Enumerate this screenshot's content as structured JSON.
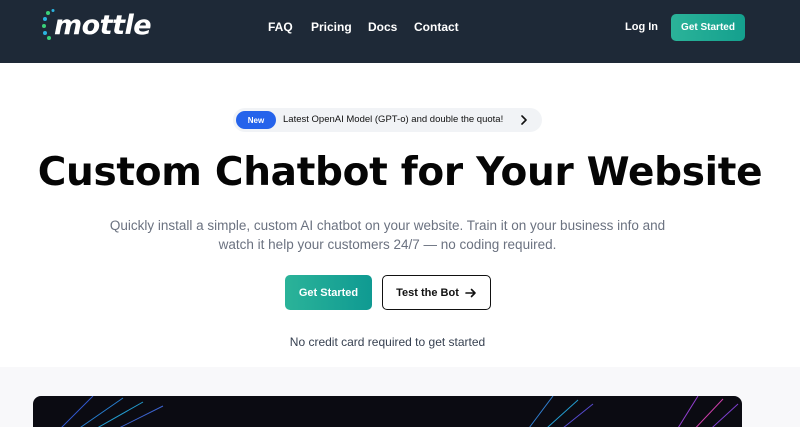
{
  "brand": {
    "name": "mottle"
  },
  "nav": {
    "links": [
      "FAQ",
      "Pricing",
      "Docs",
      "Contact"
    ],
    "login": "Log In",
    "cta": "Get Started"
  },
  "announcement": {
    "badge": "New",
    "text": "Latest OpenAI Model (GPT-o) and double the quota!"
  },
  "hero": {
    "title": "Custom Chatbot for Your Website",
    "subtitle": "Quickly install a simple, custom AI chatbot on your website. Train it on your business info and watch it help your customers 24/7 — no coding required.",
    "primary_button": "Get Started",
    "secondary_button": "Test the Bot",
    "note": "No credit card required to get started"
  },
  "colors": {
    "header_bg": "#1e2937",
    "accent": "#14a08e",
    "badge_blue": "#2563eb"
  }
}
